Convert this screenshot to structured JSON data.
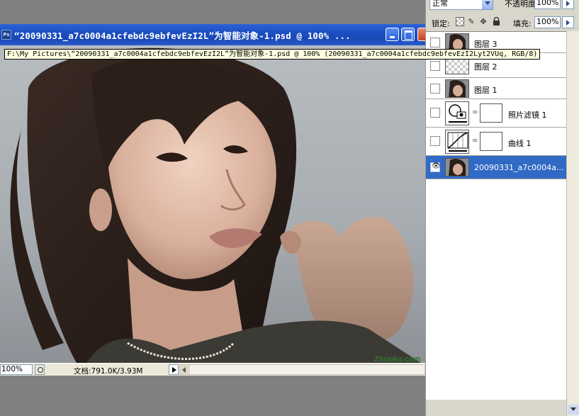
{
  "document": {
    "ps_badge": "Ps",
    "title": "“20090331_a7c0004a1cfebdc9ebfevEzI2L”为智能对象-1.psd @ 100% ...",
    "tooltip": "F:\\My Pictures\\“20090331_a7c0004a1cfebdc9ebfevEzI2L”为智能对象-1.psd @ 100% (20090331_a7c0004a1cfebdc9ebfevEzI2Lyt2VUq, RGB/8)",
    "watermark": "Zhuoku.com",
    "status": {
      "zoom": "100%",
      "doc_size": "文档:791.0K/3.93M"
    }
  },
  "layers_panel": {
    "blend_mode": "正常",
    "opacity_label": "不透明度:",
    "opacity_value": "100%",
    "lock_label": "锁定:",
    "lock_icons": [
      "lock-transparent-icon",
      "lock-paint-icon",
      "lock-move-icon",
      "lock-all-icon"
    ],
    "fill_label": "填充:",
    "fill_value": "100%",
    "layers": [
      {
        "name": "图层 3",
        "visible": false,
        "thumbnail": "photo",
        "selected": false
      },
      {
        "name": "图层 2",
        "visible": false,
        "thumbnail": "transparent",
        "selected": false
      },
      {
        "name": "图层 1",
        "visible": false,
        "thumbnail": "photo",
        "selected": false
      },
      {
        "name": "照片滤镜 1",
        "visible": false,
        "thumbnail": "photo-filter-adjustment",
        "selected": false
      },
      {
        "name": "曲线 1",
        "visible": false,
        "thumbnail": "curves-adjustment",
        "selected": false
      },
      {
        "name": "20090331_a7c0004a...",
        "visible": true,
        "thumbnail": "photo",
        "selected": true
      }
    ]
  },
  "colors": {
    "selection": "#316ac5",
    "titlebar": "#1c4ec2"
  }
}
